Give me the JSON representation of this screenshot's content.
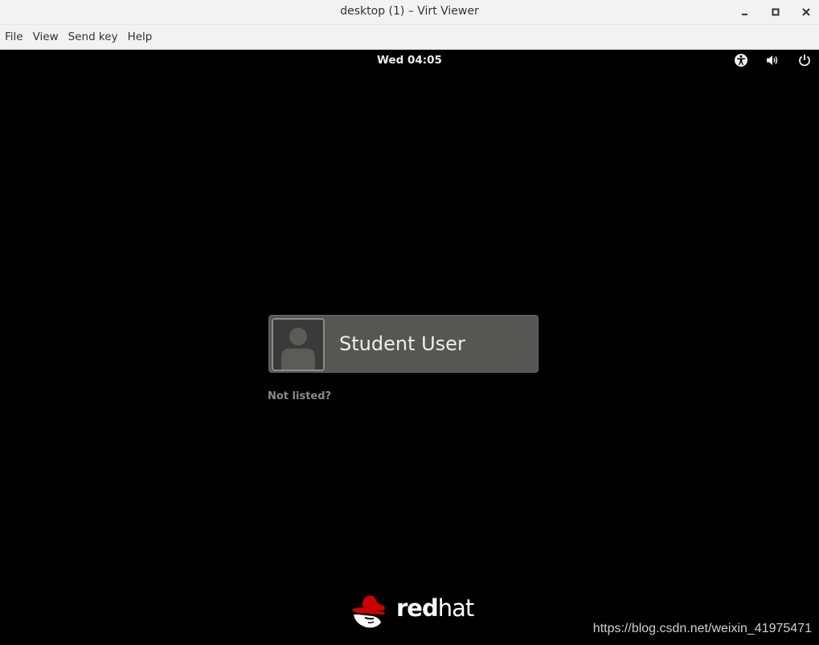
{
  "window": {
    "title": "desktop (1) – Virt Viewer"
  },
  "menubar": {
    "items": [
      {
        "label": "File"
      },
      {
        "label": "View"
      },
      {
        "label": "Send key"
      },
      {
        "label": "Help"
      }
    ]
  },
  "topbar": {
    "clock": "Wed 04:05",
    "icons": [
      "accessibility-icon",
      "volume-icon",
      "power-icon"
    ]
  },
  "login": {
    "user_name": "Student User",
    "not_listed": "Not listed?"
  },
  "logo": {
    "text_bold": "red",
    "text_thin": "hat",
    "brand_color": "#cc0000"
  },
  "watermark": {
    "text": "https://blog.csdn.net/weixin_41975471"
  }
}
